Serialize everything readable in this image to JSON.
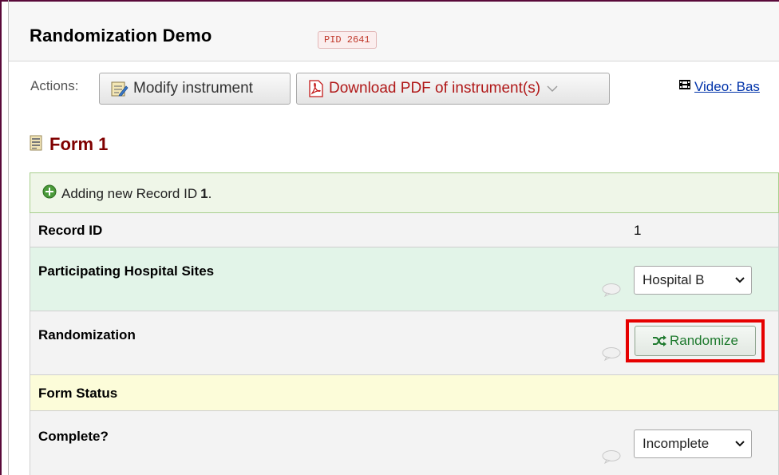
{
  "header": {
    "title": "Randomization Demo",
    "pid_badge": "PID 2641"
  },
  "actions": {
    "label": "Actions:",
    "modify_instrument": "Modify instrument",
    "download_pdf": "Download PDF of instrument(s)",
    "video_link": "Video: Bas"
  },
  "form": {
    "title": "Form 1",
    "status_message_prefix": "Adding new Record ID",
    "status_message_record": "1",
    "status_message_suffix": ".",
    "fields": {
      "record_id": {
        "label": "Record ID",
        "value": "1"
      },
      "hospital_sites": {
        "label": "Participating Hospital Sites",
        "selected": "Hospital B"
      },
      "randomization": {
        "label": "Randomization",
        "button_label": "Randomize"
      },
      "form_status_section": {
        "label": "Form Status"
      },
      "complete": {
        "label": "Complete?",
        "selected": "Incomplete"
      }
    }
  },
  "colors": {
    "form_title": "#800000",
    "pid_badge_text": "#c0392b",
    "randomize_text": "#1e7a2e",
    "highlight_border": "#e60000",
    "link": "#0033aa"
  }
}
